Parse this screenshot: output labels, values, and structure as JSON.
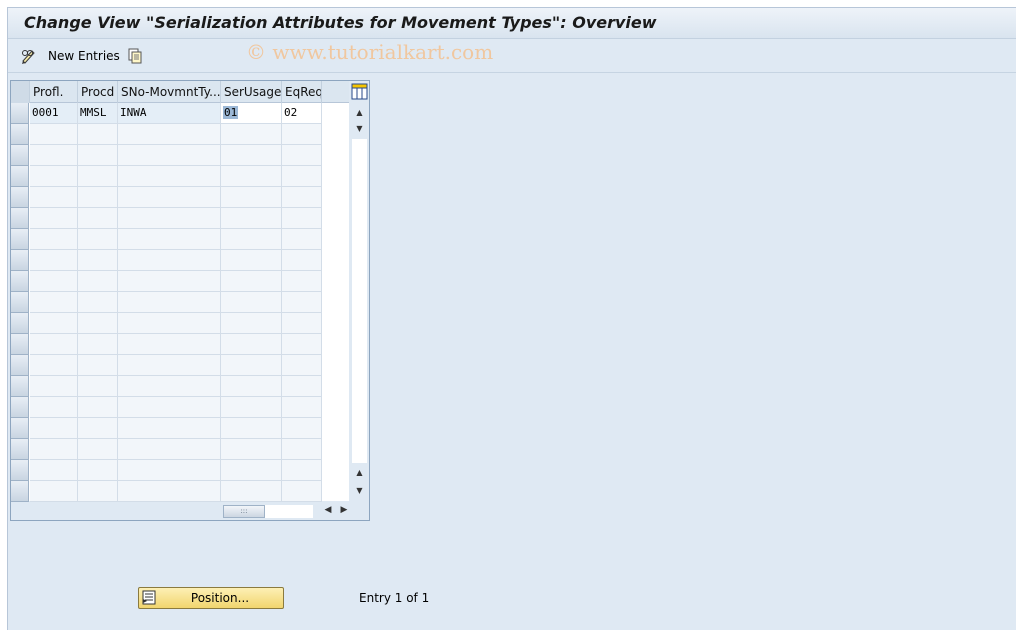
{
  "window": {
    "title": "Change View \"Serialization Attributes for Movement Types\": Overview"
  },
  "toolbar": {
    "new_entries_label": "New Entries",
    "edit_icon": "pencil-glasses-icon",
    "copy_icon": "copy-icon"
  },
  "watermark": "© www.tutorialkart.com",
  "table": {
    "columns": [
      "Profl.",
      "Procd",
      "SNo-MovmntTy...",
      "SerUsage",
      "EqReq"
    ],
    "rows": [
      [
        "0001",
        "MMSL",
        "INWA",
        "01",
        "02"
      ]
    ],
    "empty_rows": 18
  },
  "footer": {
    "position_button_label": "Position...",
    "entry_info": "Entry 1 of 1"
  }
}
